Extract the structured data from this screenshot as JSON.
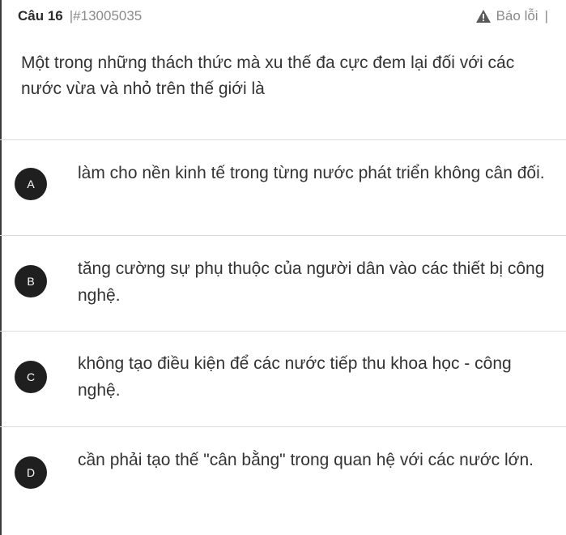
{
  "header": {
    "question_label": "Câu 16",
    "question_id": "|#13005035",
    "report_label": "Báo lỗi",
    "report_separator": "|"
  },
  "question": {
    "text": "Một trong những thách thức mà xu thế đa cực đem lại đối với các nước vừa và nhỏ trên thế giới là"
  },
  "options": [
    {
      "letter": "A",
      "text": "làm cho nền kinh tế trong từng nước phát triển không cân đối."
    },
    {
      "letter": "B",
      "text": "tăng cường sự phụ thuộc của người dân vào các thiết bị công nghệ."
    },
    {
      "letter": "C",
      "text": "không tạo điều kiện để các nước tiếp thu khoa học - công nghệ."
    },
    {
      "letter": "D",
      "text": "cần phải tạo thế \"cân bằng\" trong quan hệ với các nước lớn."
    }
  ],
  "icons": {
    "report": "warning-triangle-icon"
  },
  "colors": {
    "badge": "#1f1f1f",
    "divider": "#dcdcdc",
    "muted": "#8a8a8a"
  }
}
